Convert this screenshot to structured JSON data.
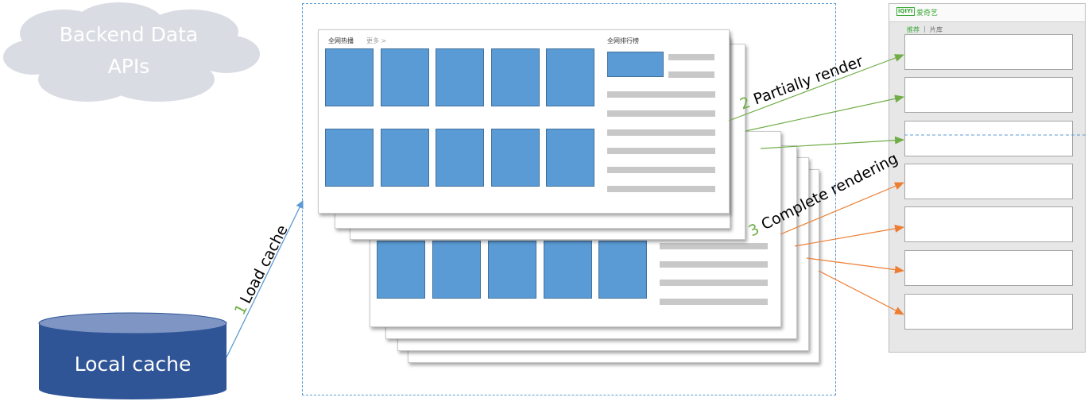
{
  "cloud": {
    "label_line1": "Backend Data",
    "label_line2": "APIs"
  },
  "database": {
    "label": "Local cache"
  },
  "steps": [
    {
      "num": "1",
      "text": "Load cache"
    },
    {
      "num": "2",
      "text": "Partially render"
    },
    {
      "num": "3",
      "text": "Complete rendering"
    }
  ],
  "page_card": {
    "section_hot": "全网热播",
    "more_link": "更多 >",
    "ranking_title": "全网排行榜"
  },
  "phone": {
    "logo_text": "iQIYI",
    "brand": "爱奇艺",
    "tab_recommend": "推荐",
    "tab_divider": "|",
    "tab_library": "片库"
  },
  "colors": {
    "tile_blue": "#5b9bd5",
    "cloud": "#d9dce3",
    "db_dark": "#2f5597",
    "db_top": "#7f96c4",
    "green": "#70ad47",
    "orange": "#ed7d31",
    "arrow_blue": "#5b9bd5"
  }
}
